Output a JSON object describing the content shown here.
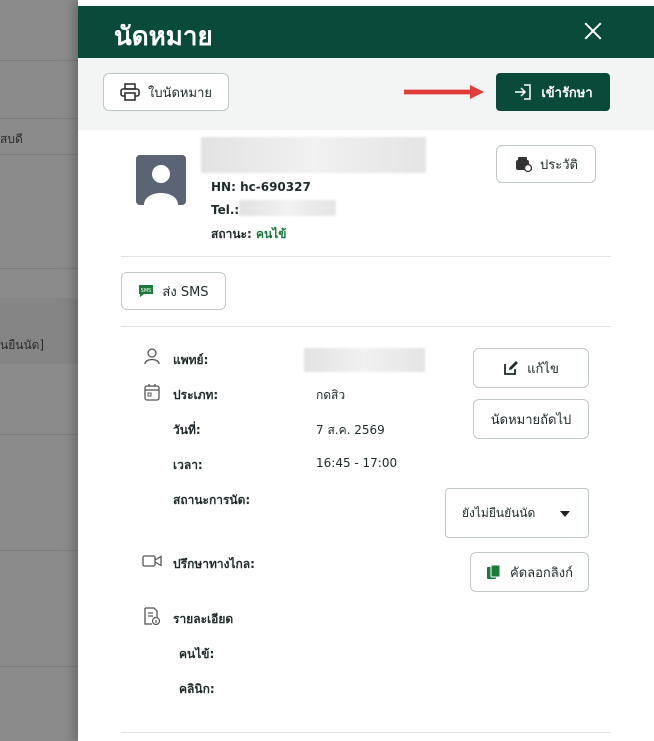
{
  "background": {
    "texts": [
      "สบดี",
      "นยืนนัด]"
    ]
  },
  "drawer": {
    "title": "นัดหมาย",
    "print_button": "ใบนัดหมาย",
    "enter_treatment_button": "เข้ารักษา",
    "history_button": "ประวัติ"
  },
  "patient": {
    "hn_label": "HN:",
    "hn_value": "hc-690327",
    "tel_label": "Tel.:",
    "status_label": "สถานะ:",
    "status_value": "คนไข้"
  },
  "sms_button": "ส่ง SMS",
  "appointment": {
    "doctor_label": "แพทย์:",
    "type_label": "ประเภท:",
    "type_value": "กดสิว",
    "date_label": "วันที่:",
    "date_value": "7 ส.ค. 2569",
    "time_label": "เวลา:",
    "time_value": "16:45 - 17:00",
    "status_label": "สถานะการนัด:",
    "status_select": "ยังไม่ยืนยันนัด",
    "edit_button": "แก้ไข",
    "next_appt_button": "นัดหมายถัดไป",
    "tele_label": "ปรึกษาทางไกล:",
    "copy_link_button": "คัดลอกลิงก์",
    "details_label": "รายละเอียด",
    "patient_label": "คนไข้:",
    "clinic_label": "คลินิก:"
  },
  "colors": {
    "brand": "#0a4a3a",
    "status_green": "#1a7a3a",
    "arrow_red": "#e23b3b"
  }
}
